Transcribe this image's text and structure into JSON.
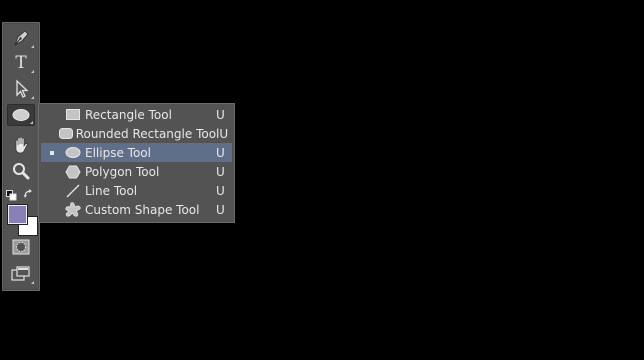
{
  "toolbar": {
    "tools": [
      {
        "name": "pen-tool",
        "icon": "pen-icon"
      },
      {
        "name": "type-tool",
        "icon": "type-icon",
        "glyph": "T"
      },
      {
        "name": "path-selection-tool",
        "icon": "arrow-select-icon"
      },
      {
        "name": "ellipse-tool",
        "icon": "ellipse-icon",
        "active": true
      },
      {
        "name": "hand-tool",
        "icon": "hand-icon"
      },
      {
        "name": "zoom-tool",
        "icon": "magnifier-icon"
      }
    ],
    "foreground_color": "#8a80b8",
    "background_color": "#ffffff"
  },
  "shape_menu": {
    "items": [
      {
        "label": "Rectangle Tool",
        "shortcut": "U",
        "icon": "rectangle-icon",
        "selected": false
      },
      {
        "label": "Rounded Rectangle Tool",
        "shortcut": "U",
        "icon": "rounded-rectangle-icon",
        "selected": false
      },
      {
        "label": "Ellipse Tool",
        "shortcut": "U",
        "icon": "ellipse-icon",
        "selected": true
      },
      {
        "label": "Polygon Tool",
        "shortcut": "U",
        "icon": "polygon-icon",
        "selected": false
      },
      {
        "label": "Line Tool",
        "shortcut": "U",
        "icon": "line-icon",
        "selected": false
      },
      {
        "label": "Custom Shape Tool",
        "shortcut": "U",
        "icon": "custom-shape-icon",
        "selected": false
      }
    ]
  }
}
